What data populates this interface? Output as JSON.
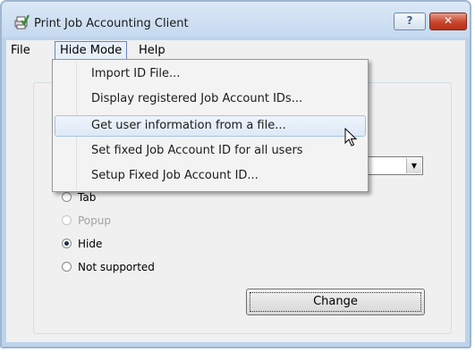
{
  "window": {
    "title": "Print Job Accounting Client",
    "help_button": "?",
    "close_button": "✕"
  },
  "menubar": {
    "items": [
      {
        "label": "File"
      },
      {
        "label": "Hide Mode"
      },
      {
        "label": "Help"
      }
    ]
  },
  "hide_mode_menu": {
    "items": [
      {
        "label": "Import ID File..."
      },
      {
        "label": "Display registered Job Account IDs..."
      },
      {
        "label": "Get user information from a file..."
      },
      {
        "label": "Set fixed Job Account ID for all users"
      },
      {
        "label": "Setup Fixed Job Account ID..."
      }
    ],
    "highlighted_index": 2
  },
  "dialog": {
    "combo_value": "",
    "radio_options": [
      {
        "label": "Tab",
        "checked": false,
        "enabled": true
      },
      {
        "label": "Popup",
        "checked": false,
        "enabled": false
      },
      {
        "label": "Hide",
        "checked": true,
        "enabled": true
      },
      {
        "label": "Not supported",
        "checked": false,
        "enabled": true
      }
    ],
    "change_button": "Change"
  },
  "icons": {
    "app": "printer-check-icon",
    "combo_arrow": "chevron-down-icon",
    "cursor": "mouse-pointer-icon"
  }
}
